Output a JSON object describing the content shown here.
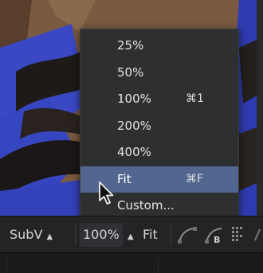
{
  "zoom_menu": {
    "items": [
      {
        "label": "25%",
        "shortcut": ""
      },
      {
        "label": "50%",
        "shortcut": ""
      },
      {
        "label": "100%",
        "shortcut": "⌘1"
      },
      {
        "label": "200%",
        "shortcut": ""
      },
      {
        "label": "400%",
        "shortcut": ""
      },
      {
        "label": "Fit",
        "shortcut": "⌘F"
      },
      {
        "label": "Custom...",
        "shortcut": ""
      }
    ],
    "selected_label": "Fit"
  },
  "toolbar": {
    "subview_label": "SubV",
    "zoom_value": "100%",
    "fit_label": "Fit",
    "subview_caret": "▲",
    "zoom_caret": "▲"
  },
  "colors": {
    "menu_bg": "#2e2f31",
    "menu_selected": "#52668f",
    "toolbar_bg": "#232425",
    "viewer_blue": "#3a4fc9"
  },
  "icons": [
    "spline-icon",
    "spline-b-icon",
    "grid-dots-icon",
    "mouse-pointer-icon"
  ]
}
